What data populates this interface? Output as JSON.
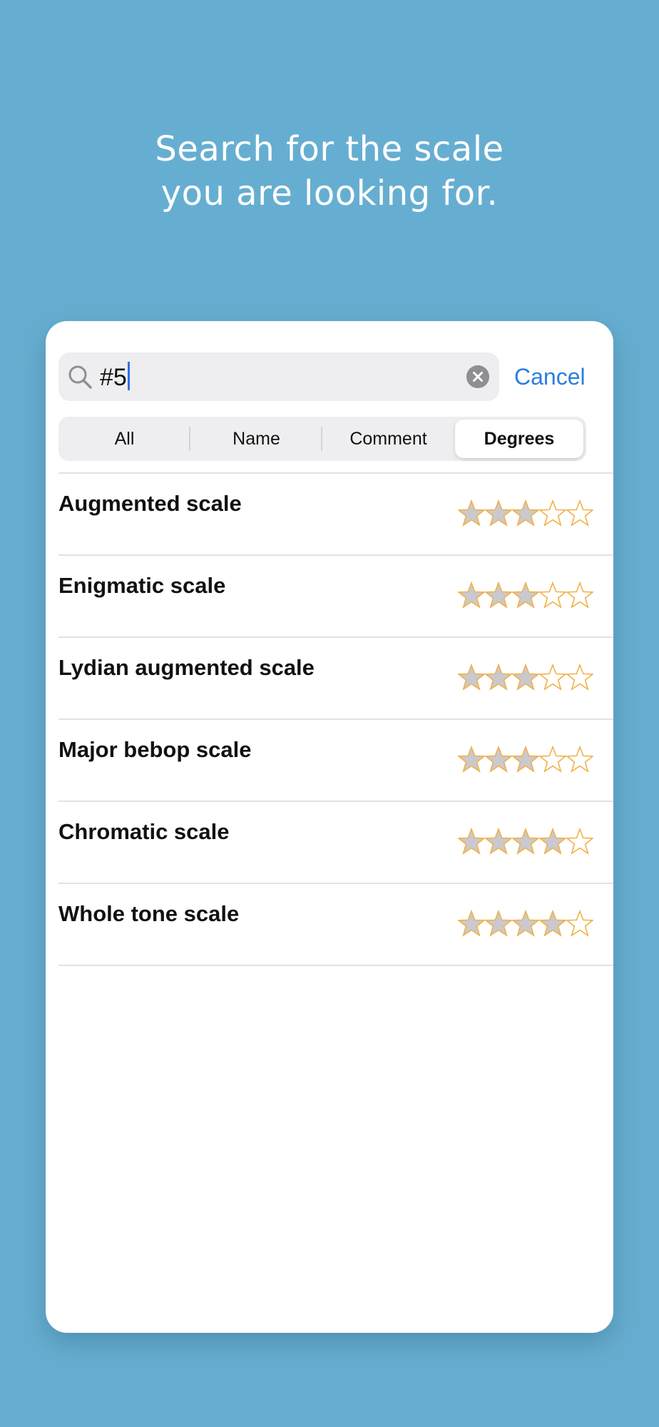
{
  "headline": {
    "line1": "Search for the scale",
    "line2": "you are  looking for."
  },
  "search": {
    "value": "#5",
    "icon": "magnifier-icon",
    "clear_icon": "clear-x-icon",
    "cancel_label": "Cancel"
  },
  "tabs": [
    {
      "label": "All",
      "selected": false
    },
    {
      "label": "Name",
      "selected": false
    },
    {
      "label": "Comment",
      "selected": false
    },
    {
      "label": "Degrees",
      "selected": true
    }
  ],
  "results": [
    {
      "name": "Augmented scale",
      "rating": 3,
      "max_rating": 5
    },
    {
      "name": "Enigmatic scale",
      "rating": 3,
      "max_rating": 5
    },
    {
      "name": "Lydian augmented scale",
      "rating": 3,
      "max_rating": 5
    },
    {
      "name": "Major bebop scale",
      "rating": 3,
      "max_rating": 5
    },
    {
      "name": "Chromatic scale",
      "rating": 4,
      "max_rating": 5
    },
    {
      "name": "Whole tone scale",
      "rating": 4,
      "max_rating": 5
    }
  ],
  "colors": {
    "background": "#66aed1",
    "accent": "#2a7de1",
    "star_outline": "#f0b24a",
    "star_fill": "#c9c9cf"
  }
}
